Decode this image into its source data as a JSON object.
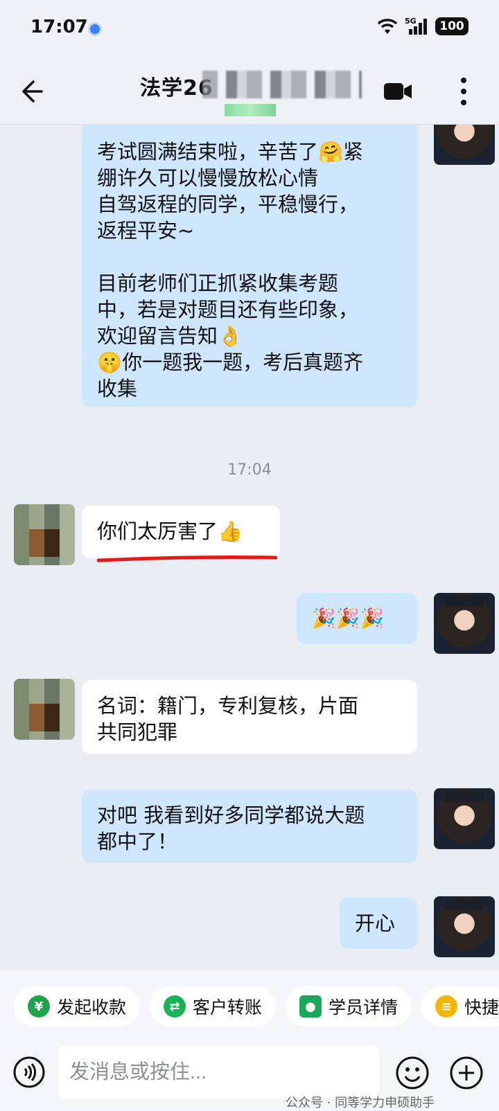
{
  "status_bar": {
    "time": "17:07",
    "network": "5G",
    "battery": "100"
  },
  "header": {
    "title": "法学26"
  },
  "messages": [
    {
      "text": "考试圆满结束啦，辛苦了🤗紧\n绷许久可以慢慢放松心情\n自驾返程的同学，平稳慢行，\n返程平安~\n\n目前老师们正抓紧收集考题\n中，若是对题目还有些印象，\n欢迎留言告知👌\n🤫你一题我一题，考后真题齐\n收集"
    },
    {
      "time": "17:04"
    },
    {
      "text": "你们太厉害了👍"
    },
    {
      "text": "🎉🎉🎉"
    },
    {
      "text": "名词：籍门，专利复核，片面\n共同犯罪"
    },
    {
      "text": "对吧 我看到好多同学都说大题\n都中了！"
    },
    {
      "text": "开心"
    }
  ],
  "quick_actions": [
    {
      "label": "发起收款",
      "color": "#1fa34a",
      "icon": "yen-icon"
    },
    {
      "label": "客户转账",
      "color": "#19b356",
      "icon": "transfer-icon"
    },
    {
      "label": "学员详情",
      "color": "#19a85a",
      "icon": "person-icon"
    },
    {
      "label": "快捷",
      "color": "#f2b600",
      "icon": "chat-icon"
    }
  ],
  "input": {
    "placeholder": "发消息或按住..."
  },
  "watermark": "公众号 · 同等学力申硕助手"
}
